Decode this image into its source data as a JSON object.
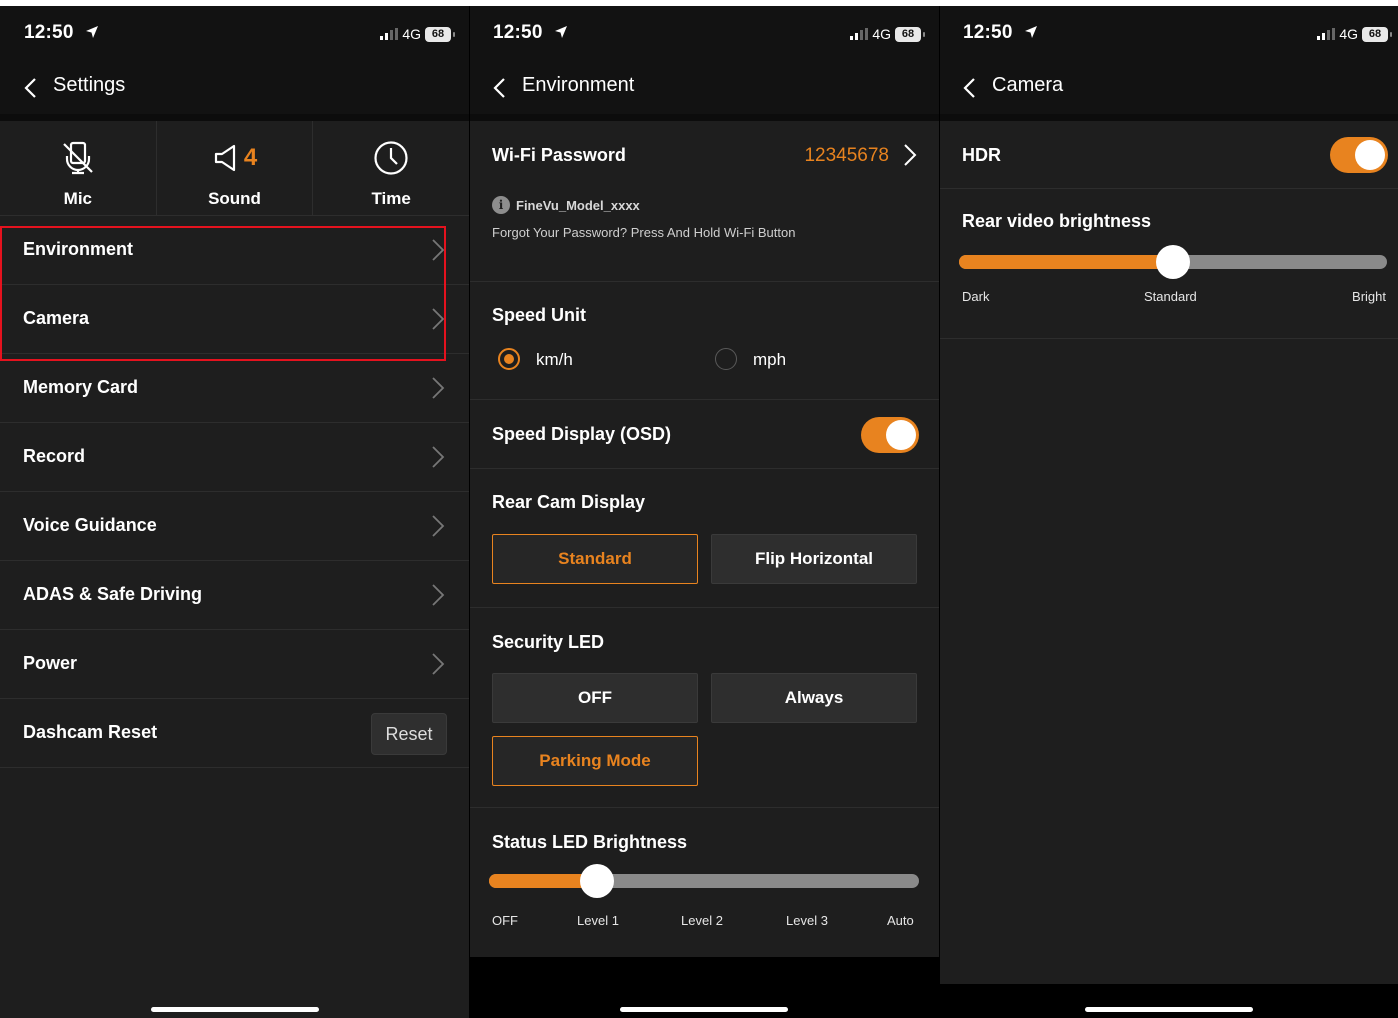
{
  "colors": {
    "accent": "#e8831f",
    "highlight": "#e5121e",
    "background": "#1e1e1e"
  },
  "statusbar": {
    "time": "12:50",
    "network": "4G",
    "battery": "68"
  },
  "settings": {
    "title": "Settings",
    "quick": [
      {
        "label": "Mic",
        "icon": "mic-off-icon"
      },
      {
        "label": "Sound",
        "badge": "4",
        "icon": "speaker-icon"
      },
      {
        "label": "Time",
        "icon": "clock-icon"
      }
    ],
    "items": [
      {
        "label": "Environment"
      },
      {
        "label": "Camera"
      },
      {
        "label": "Memory Card"
      },
      {
        "label": "Record"
      },
      {
        "label": "Voice Guidance"
      },
      {
        "label": "ADAS & Safe Driving"
      },
      {
        "label": "Power"
      }
    ],
    "reset": {
      "label": "Dashcam Reset",
      "button": "Reset"
    }
  },
  "environment": {
    "title": "Environment",
    "wifi": {
      "label": "Wi-Fi Password",
      "value": "12345678",
      "ssid": "FineVu_Model_xxxx",
      "hint": "Forgot Your Password? Press And Hold Wi-Fi Button"
    },
    "speed_unit": {
      "label": "Speed Unit",
      "options": [
        "km/h",
        "mph"
      ],
      "selected": "km/h"
    },
    "speed_display": {
      "label": "Speed Display (OSD)",
      "on": true
    },
    "rear_cam": {
      "label": "Rear Cam Display",
      "options": [
        "Standard",
        "Flip Horizontal"
      ],
      "selected": "Standard"
    },
    "security_led": {
      "label": "Security LED",
      "options": [
        "OFF",
        "Always",
        "Parking Mode"
      ],
      "selected": "Parking Mode"
    },
    "status_led": {
      "label": "Status LED Brightness",
      "ticks": [
        "OFF",
        "Level 1",
        "Level 2",
        "Level 3",
        "Auto"
      ],
      "value_index": 1
    }
  },
  "camera": {
    "title": "Camera",
    "hdr": {
      "label": "HDR",
      "on": true
    },
    "rear_brightness": {
      "label": "Rear video brightness",
      "ticks": [
        "Dark",
        "Standard",
        "Bright"
      ],
      "value_index": 1
    }
  }
}
